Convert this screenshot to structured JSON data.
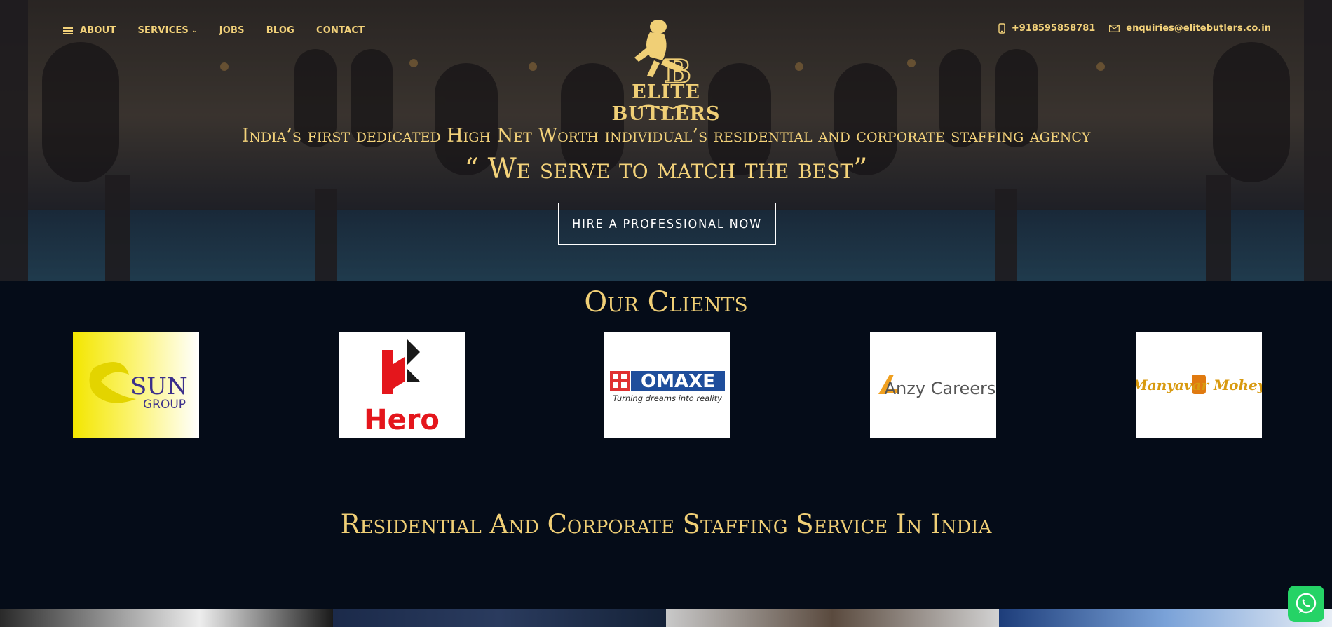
{
  "nav": {
    "items": [
      {
        "label": "ABOUT"
      },
      {
        "label": "SERVICES"
      },
      {
        "label": "JOBS"
      },
      {
        "label": "BLOG"
      },
      {
        "label": "CONTACT"
      }
    ]
  },
  "contact": {
    "phone": "+918595858781",
    "email": "enquiries@elitebutlers.co.in"
  },
  "logo": {
    "text": "ELITE BUTLERS"
  },
  "hero": {
    "tagline": "India’s first dedicated High Net Worth individual’s residential and corporate staffing agency",
    "motto": "“ We serve to match the best”",
    "cta_label": "HIRE A PROFESSIONAL NOW"
  },
  "clients": {
    "title": "Our Clients",
    "logos": [
      {
        "name": "SUN",
        "sub": "GROUP"
      },
      {
        "name": "Hero"
      },
      {
        "name": "OMAXE",
        "sub": "Turning dreams into reality"
      },
      {
        "name": "Anzy Careers"
      },
      {
        "name": "Manyavar Mohey"
      }
    ]
  },
  "section": {
    "title": "Residential And Corporate Staffing Service In India"
  },
  "colors": {
    "accent": "#f3d27a",
    "background": "#050c18",
    "whatsapp": "#25d366"
  },
  "icons": {
    "menu": "menu-icon",
    "phone": "phone-icon",
    "email": "mail-icon",
    "whatsapp": "whatsapp-icon"
  }
}
